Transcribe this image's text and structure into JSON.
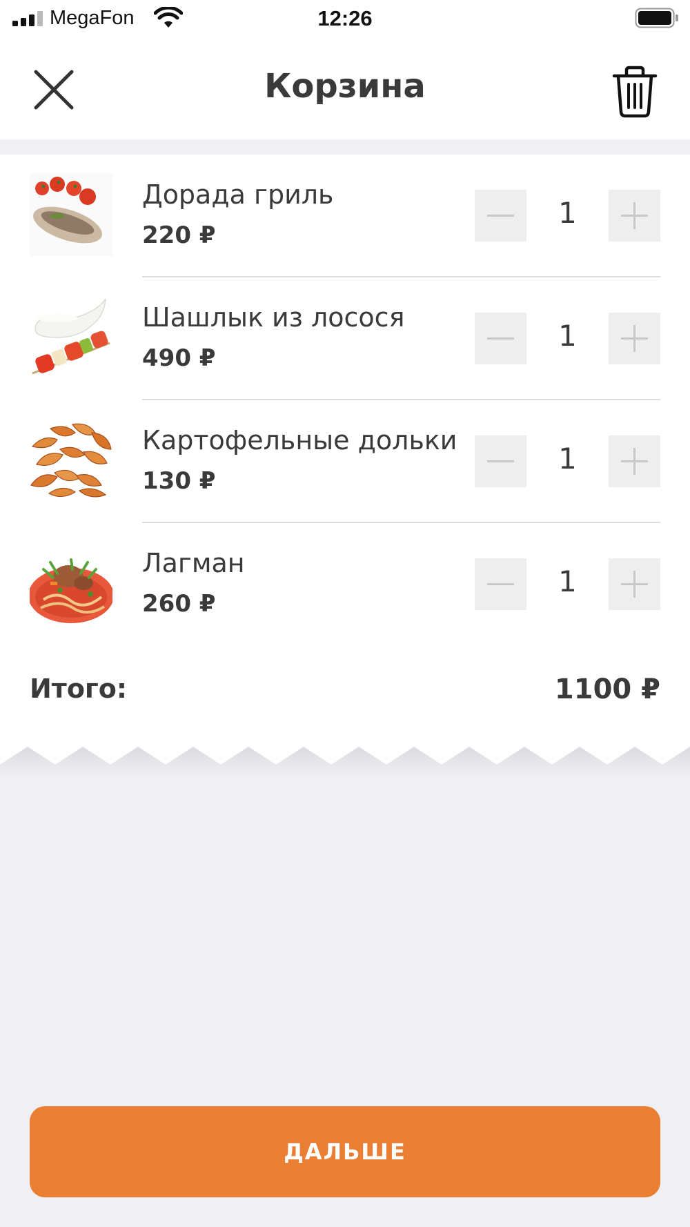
{
  "status_bar": {
    "carrier": "MegaFon",
    "time": "12:26"
  },
  "header": {
    "title": "Корзина",
    "close_icon": "close-icon",
    "trash_icon": "trash-icon"
  },
  "cart": {
    "items": [
      {
        "name": "Дорада гриль",
        "price": "220 ₽",
        "quantity": "1",
        "image": "grilled-dorado-image"
      },
      {
        "name": "Шашлык из лосося",
        "price": "490 ₽",
        "quantity": "1",
        "image": "salmon-skewer-image"
      },
      {
        "name": "Картофельные дольки",
        "price": "130 ₽",
        "quantity": "1",
        "image": "potato-wedges-image"
      },
      {
        "name": "Лагман",
        "price": "260 ₽",
        "quantity": "1",
        "image": "lagman-image"
      }
    ],
    "total_label": "Итого:",
    "total_value": "1100 ₽"
  },
  "footer": {
    "next_label": "ДАЛЬШЕ"
  },
  "colors": {
    "accent": "#ea7f33",
    "background": "#efeff4",
    "text": "#3a3a3a",
    "stepper_bg": "#eeeeee"
  }
}
